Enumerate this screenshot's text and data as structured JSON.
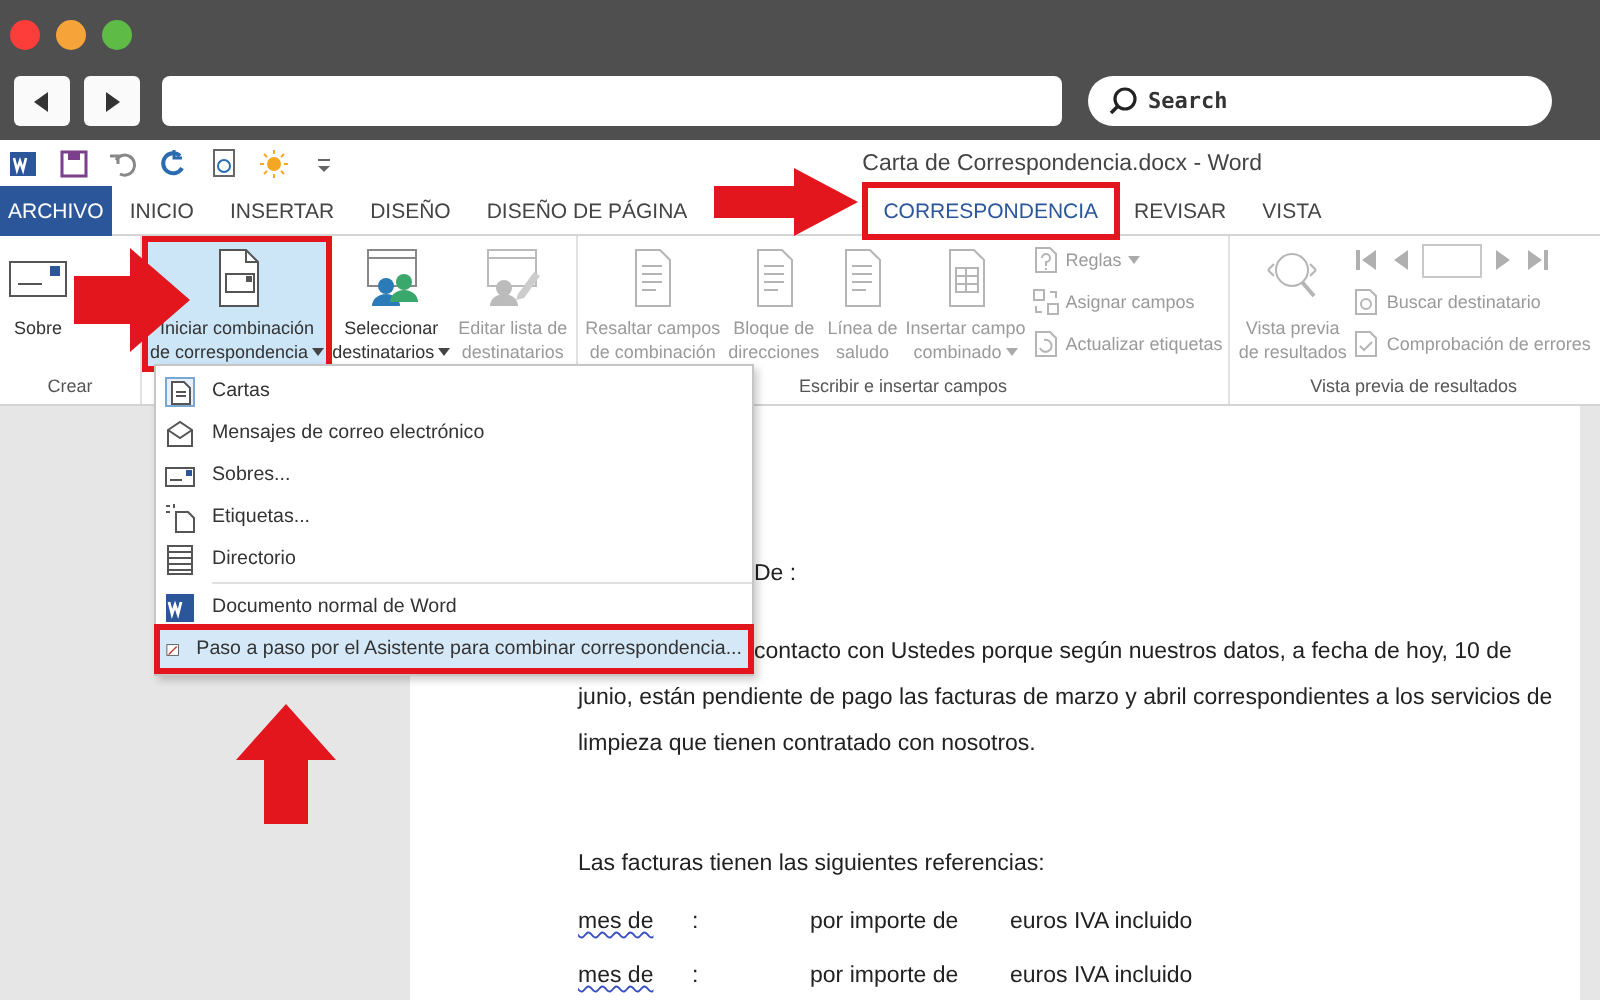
{
  "browser": {
    "lights": [
      {
        "color": "#fc3d39"
      },
      {
        "color": "#f6a33a"
      },
      {
        "color": "#5dbb46"
      }
    ],
    "search": {
      "placeholder": "Search"
    }
  },
  "window": {
    "title": "Carta de Correspondencia.docx - Word"
  },
  "tabs": [
    {
      "label": "ARCHIVO",
      "kind": "file",
      "selected": false,
      "highlighted": false
    },
    {
      "label": "INICIO",
      "kind": "tab",
      "selected": false,
      "highlighted": false
    },
    {
      "label": "INSERTAR",
      "kind": "tab",
      "selected": false,
      "highlighted": false
    },
    {
      "label": "DISEÑO",
      "kind": "tab",
      "selected": false,
      "highlighted": false
    },
    {
      "label": "DISEÑO DE PÁGINA",
      "kind": "tab",
      "selected": false,
      "highlighted": false
    },
    {
      "label": "CORRESPONDENCIA",
      "kind": "tab",
      "selected": true,
      "highlighted": true
    },
    {
      "label": "REVISAR",
      "kind": "tab",
      "selected": false,
      "highlighted": false
    },
    {
      "label": "VISTA",
      "kind": "tab",
      "selected": false,
      "highlighted": false
    }
  ],
  "ribbon": {
    "groups": [
      {
        "label": "Crear",
        "items": [
          {
            "kind": "large",
            "lines": [
              "Sobre"
            ],
            "disabled": false,
            "selected": false,
            "highlighted": false,
            "dropdown": false
          }
        ]
      },
      {
        "items": [
          {
            "kind": "large",
            "lines": [
              "Iniciar combinación",
              "de correspondencia"
            ],
            "disabled": false,
            "selected": true,
            "highlighted": true,
            "dropdown": true
          },
          {
            "kind": "large",
            "lines": [
              "Seleccionar",
              "destinatarios"
            ],
            "disabled": false,
            "selected": false,
            "highlighted": false,
            "dropdown": true
          },
          {
            "kind": "large",
            "lines": [
              "Editar lista de",
              "destinatarios"
            ],
            "disabled": true,
            "selected": false,
            "highlighted": false,
            "dropdown": false
          }
        ]
      },
      {
        "label": "Escribir e insertar campos",
        "items": [
          {
            "kind": "large",
            "lines": [
              "Resaltar campos",
              "de combinación"
            ],
            "disabled": true,
            "selected": false,
            "highlighted": false,
            "dropdown": false
          },
          {
            "kind": "large",
            "lines": [
              "Bloque de",
              "direcciones"
            ],
            "disabled": true,
            "selected": false,
            "highlighted": false,
            "dropdown": false
          },
          {
            "kind": "large",
            "lines": [
              "Línea de",
              "saludo"
            ],
            "disabled": true,
            "selected": false,
            "highlighted": false,
            "dropdown": false
          },
          {
            "kind": "large",
            "lines": [
              "Insertar campo",
              "combinado"
            ],
            "disabled": true,
            "selected": false,
            "highlighted": false,
            "dropdown": true
          },
          {
            "kind": "stack",
            "buttons": [
              {
                "kind": "small",
                "label": "Reglas",
                "disabled": true,
                "dropdown": true
              },
              {
                "kind": "small",
                "label": "Asignar campos",
                "disabled": true,
                "dropdown": false
              },
              {
                "kind": "small",
                "label": "Actualizar etiquetas",
                "disabled": true,
                "dropdown": false
              }
            ]
          }
        ]
      },
      {
        "label": "Vista previa de resultados",
        "items": [
          {
            "kind": "large",
            "lines": [
              "Vista previa",
              "de resultados"
            ],
            "disabled": true,
            "selected": false,
            "highlighted": false,
            "dropdown": false
          },
          {
            "kind": "stack",
            "buttons": [
              {
                "kind": "record_nav",
                "disabled": true
              },
              {
                "kind": "small",
                "label": "Buscar destinatario",
                "disabled": true,
                "dropdown": false
              },
              {
                "kind": "small",
                "label": "Comprobación de errores",
                "disabled": true,
                "dropdown": false
              }
            ]
          }
        ]
      }
    ]
  },
  "menu": {
    "items": [
      {
        "label": "Cartas",
        "selected": false,
        "highlighted": false,
        "separator_before": false
      },
      {
        "label": "Mensajes de correo electrónico",
        "selected": false,
        "highlighted": false,
        "separator_before": false
      },
      {
        "label": "Sobres...",
        "selected": false,
        "highlighted": false,
        "separator_before": false
      },
      {
        "label": "Etiquetas...",
        "selected": false,
        "highlighted": false,
        "separator_before": false
      },
      {
        "label": "Directorio",
        "selected": false,
        "highlighted": false,
        "separator_before": false
      },
      {
        "label": "Documento normal de Word",
        "selected": false,
        "highlighted": false,
        "separator_before": true
      },
      {
        "label": "Paso a paso por el Asistente para combinar correspondencia...",
        "selected": true,
        "highlighted": true,
        "separator_before": false
      }
    ]
  },
  "document": {
    "paragraphs": [
      {
        "kind": "covered",
        "lines": [
          "De  :"
        ]
      },
      {
        "kind": "covered",
        "lines": [
          "contacto con Ustedes porque según nuestros datos, a fecha de hoy, 10 de",
          "junio, están pendiente de pago las facturas de marzo y abril correspondientes a los servicios de",
          "limpieza que tienen contratado con nosotros."
        ]
      },
      {
        "kind": "list_intro",
        "lines": [
          "Las facturas tienen las siguientes referencias:"
        ]
      },
      {
        "kind": "entry",
        "misspelled": true,
        "cells": [
          "mes de",
          ":",
          "por importe de",
          "euros IVA incluido"
        ]
      },
      {
        "kind": "entry",
        "misspelled": true,
        "cells": [
          "mes de",
          ":",
          "por importe de",
          "euros IVA incluido"
        ]
      }
    ]
  }
}
